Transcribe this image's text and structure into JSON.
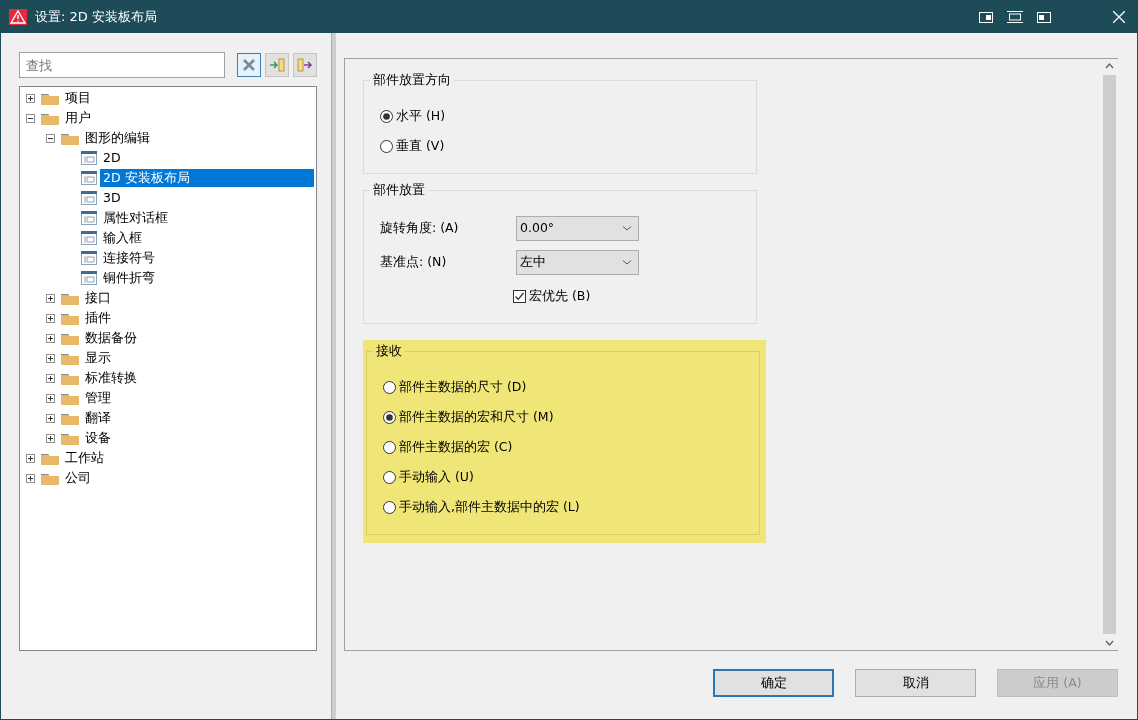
{
  "window": {
    "title": "设置: 2D 安装板布局"
  },
  "search": {
    "placeholder": "查找"
  },
  "tree": [
    {
      "label": "项目",
      "kind": "folder",
      "expanded": false,
      "selected": false
    },
    {
      "label": "用户",
      "kind": "folder",
      "expanded": true,
      "selected": false,
      "children": [
        {
          "label": "图形的编辑",
          "kind": "folder",
          "expanded": true,
          "selected": false,
          "children": [
            {
              "label": "2D",
              "kind": "page",
              "selected": false
            },
            {
              "label": "2D 安装板布局",
              "kind": "page",
              "selected": true
            },
            {
              "label": "3D",
              "kind": "page",
              "selected": false
            },
            {
              "label": "属性对话框",
              "kind": "page",
              "selected": false
            },
            {
              "label": "输入框",
              "kind": "page",
              "selected": false
            },
            {
              "label": "连接符号",
              "kind": "page",
              "selected": false
            },
            {
              "label": "铜件折弯",
              "kind": "page",
              "selected": false
            }
          ]
        },
        {
          "label": "接口",
          "kind": "folder",
          "expanded": false,
          "selected": false
        },
        {
          "label": "插件",
          "kind": "folder",
          "expanded": false,
          "selected": false
        },
        {
          "label": "数据备份",
          "kind": "folder",
          "expanded": false,
          "selected": false
        },
        {
          "label": "显示",
          "kind": "folder",
          "expanded": false,
          "selected": false
        },
        {
          "label": "标准转换",
          "kind": "folder",
          "expanded": false,
          "selected": false
        },
        {
          "label": "管理",
          "kind": "folder",
          "expanded": false,
          "selected": false
        },
        {
          "label": "翻译",
          "kind": "folder",
          "expanded": false,
          "selected": false
        },
        {
          "label": "设备",
          "kind": "folder",
          "expanded": false,
          "selected": false
        }
      ]
    },
    {
      "label": "工作站",
      "kind": "folder",
      "expanded": false,
      "selected": false
    },
    {
      "label": "公司",
      "kind": "folder",
      "expanded": false,
      "selected": false
    }
  ],
  "groups": [
    {
      "title": "部件放置方向",
      "highlighted": false,
      "items": [
        {
          "kind": "radio",
          "label": "水平 (H)",
          "selected": true
        },
        {
          "kind": "radio",
          "label": "垂直 (V)",
          "selected": false
        }
      ]
    },
    {
      "title": "部件放置",
      "highlighted": false,
      "items": [
        {
          "kind": "dropdown",
          "label": "旋转角度: (A)",
          "value": "0.00°"
        },
        {
          "kind": "dropdown",
          "label": "基准点: (N)",
          "value": "左中"
        },
        {
          "kind": "checkbox",
          "label": "宏优先 (B)",
          "checked": true
        }
      ]
    },
    {
      "title": "接收",
      "highlighted": true,
      "items": [
        {
          "kind": "radio",
          "label": "部件主数据的尺寸 (D)",
          "selected": false
        },
        {
          "kind": "radio",
          "label": "部件主数据的宏和尺寸 (M)",
          "selected": true
        },
        {
          "kind": "radio",
          "label": "部件主数据的宏 (C)",
          "selected": false
        },
        {
          "kind": "radio",
          "label": "手动输入  (U)",
          "selected": false
        },
        {
          "kind": "radio",
          "label": "手动输入,部件主数据中的宏 (L)",
          "selected": false
        }
      ]
    }
  ],
  "buttons": [
    {
      "label": "确定",
      "default": true,
      "disabled": false
    },
    {
      "label": "取消",
      "default": false,
      "disabled": false
    },
    {
      "label": "应用 (A)",
      "default": false,
      "disabled": true
    }
  ]
}
